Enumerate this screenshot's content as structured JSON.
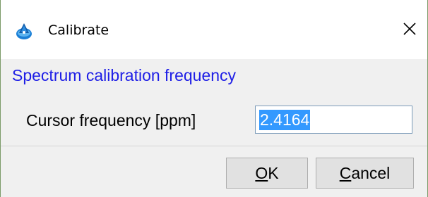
{
  "window": {
    "title": "Calibrate",
    "app_icon": "app-logo-icon",
    "close_icon": "close-icon"
  },
  "section": {
    "title": "Spectrum calibration frequency"
  },
  "field": {
    "label": "Cursor frequency [ppm]",
    "value": "2.4164"
  },
  "buttons": {
    "ok": {
      "mnemonic": "O",
      "rest": "K"
    },
    "cancel": {
      "mnemonic": "C",
      "rest": "ancel"
    }
  },
  "colors": {
    "section_title": "#1e1ee6",
    "selection": "#3399ff",
    "button_face": "#e1e1e1",
    "background": "#f0f0f0"
  }
}
